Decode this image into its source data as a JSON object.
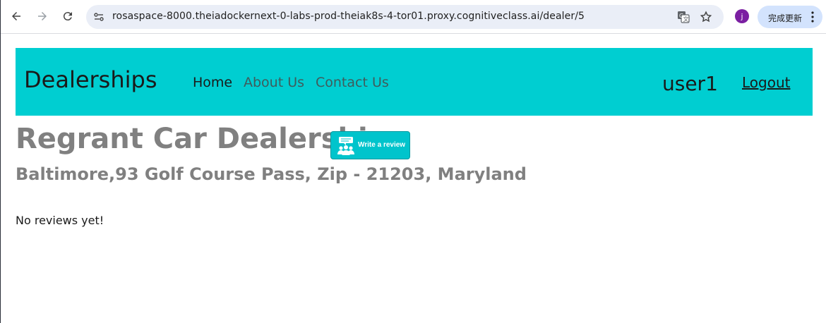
{
  "browser": {
    "url": "rosaspace-8000.theiadockernext-0-labs-prod-theiak8s-4-tor01.proxy.cognitiveclass.ai/dealer/5",
    "profile_initial": "j",
    "update_label": "完成更新",
    "icons": [
      "back-icon",
      "forward-icon",
      "reload-icon",
      "site-info-icon",
      "translate-icon",
      "star-icon",
      "kebab-menu-icon"
    ]
  },
  "navbar": {
    "brand": "Dealerships",
    "links": [
      "Home",
      "About Us",
      "Contact Us"
    ],
    "username": "user1",
    "logout": "Logout",
    "background": "#00ced1"
  },
  "dealer": {
    "name": "Regrant Car Dealership",
    "address": "Baltimore,93 Golf Course Pass, Zip - 21203, Maryland",
    "review_button": "Write a review",
    "no_reviews": "No reviews yet!"
  }
}
